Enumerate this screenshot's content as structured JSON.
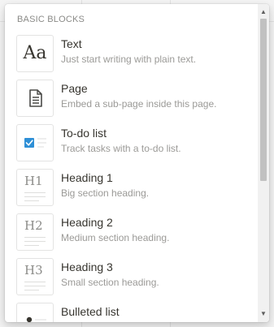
{
  "menu": {
    "section_header": "BASIC BLOCKS",
    "items": [
      {
        "title": "Text",
        "description": "Just start writing with plain text.",
        "icon": "text-aa-icon",
        "glyph": "Aa"
      },
      {
        "title": "Page",
        "description": "Embed a sub-page inside this page.",
        "icon": "page-document-icon"
      },
      {
        "title": "To-do list",
        "description": "Track tasks with a to-do list.",
        "icon": "todo-checkbox-icon"
      },
      {
        "title": "Heading 1",
        "description": "Big section heading.",
        "icon": "heading-1-icon",
        "glyph": "H1"
      },
      {
        "title": "Heading 2",
        "description": "Medium section heading.",
        "icon": "heading-2-icon",
        "glyph": "H2"
      },
      {
        "title": "Heading 3",
        "description": "Small section heading.",
        "icon": "heading-3-icon",
        "glyph": "H3"
      },
      {
        "title": "Bulleted list",
        "description": "",
        "icon": "bulleted-list-icon"
      }
    ]
  },
  "scrollbar": {
    "up_icon": "scroll-up-arrow-icon",
    "down_icon": "scroll-down-arrow-icon"
  },
  "colors": {
    "checkbox_blue": "#2e8fd6",
    "title_text": "#37352f",
    "description_text": "#9b9a97"
  }
}
